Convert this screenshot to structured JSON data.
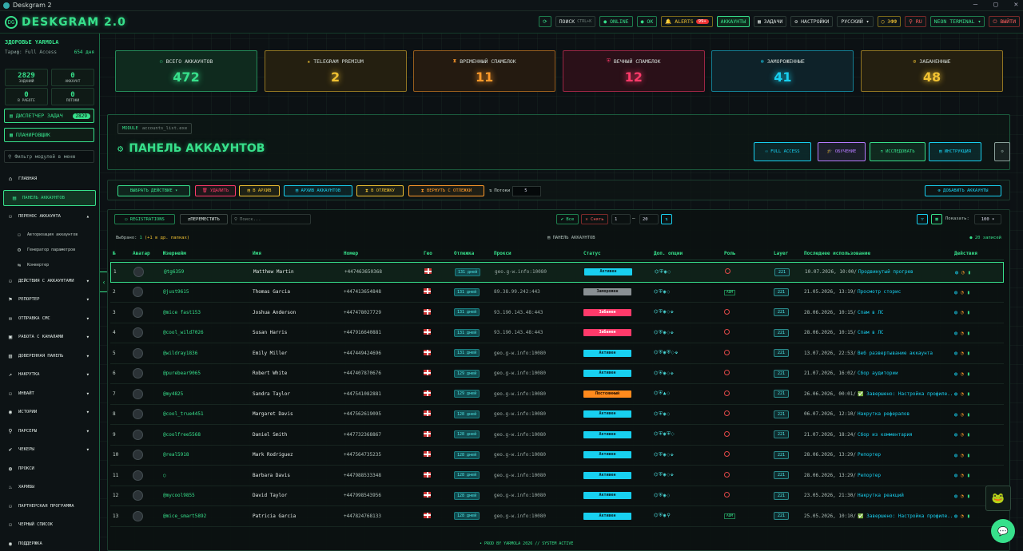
{
  "window": {
    "title": "Deskgram 2",
    "minimize": "—",
    "maximize": "▢",
    "close": "✕"
  },
  "header": {
    "logo": "DESKGRAM 2.0",
    "buttons": [
      {
        "label": "⟳",
        "cls": "g",
        "name": "refresh-button"
      },
      {
        "label": "ПОИСК",
        "extra": "CTRL+K",
        "cls": "",
        "name": "search-button"
      },
      {
        "label": "● ONLINE",
        "cls": "g",
        "name": "online-status-button"
      },
      {
        "label": "● OK",
        "cls": "g",
        "name": "ok-status-button"
      },
      {
        "label": "🔔 ALERTS",
        "badge": "99+",
        "cls": "y",
        "name": "alerts-button"
      },
      {
        "label": "АККАУНТЫ",
        "cls": "act",
        "name": "accounts-tab-button"
      },
      {
        "label": "▦ ЗАДАЧИ",
        "cls": "",
        "name": "tasks-button"
      },
      {
        "label": "⚙ НАСТРОЙКИ",
        "cls": "",
        "name": "settings-button"
      },
      {
        "label": "РУССКИЙ ▾",
        "cls": "",
        "name": "language-select"
      },
      {
        "label": "◯ ЭФФ",
        "cls": "y",
        "name": "effects-toggle"
      },
      {
        "label": "⚲ RU",
        "cls": "r",
        "name": "region-button"
      },
      {
        "label": "NEON TERMINAL ▾",
        "cls": "g",
        "name": "theme-select"
      },
      {
        "label": "⏻ ВЫЙТИ",
        "cls": "r",
        "name": "logout-button"
      }
    ]
  },
  "sidebar": {
    "user": "ЗДОРОВЬЕ YARMOLA",
    "plan": "Тариф: Full Access",
    "days": "654 дня",
    "stats": [
      {
        "n": "2829",
        "l": "ЗАДАНИЙ"
      },
      {
        "n": "0",
        "l": "АККАУНТ"
      },
      {
        "n": "0",
        "l": "В РАБОТЕ"
      },
      {
        "n": "0",
        "l": "ПОТОКИ"
      }
    ],
    "dispatcher": "ДИСПЕТЧЕР ЗАДАЧ",
    "dispatcher_badge": "2829",
    "scheduler": "ПЛАНИРОВЩИК",
    "filter_placeholder": "Фильтр модулей в меню",
    "nav": [
      {
        "label": "ГЛАВНАЯ",
        "icon": "⌂",
        "t": "main"
      },
      {
        "label": "ПАНЕЛЬ АККАУНТОВ",
        "icon": "▤",
        "t": "active"
      },
      {
        "label": "ПЕРЕНОС АККАУНТА",
        "icon": "⚇",
        "t": "open"
      },
      {
        "label": "Авторизация аккаунтов",
        "icon": "⚇",
        "t": "sub"
      },
      {
        "label": "Генератор параметров",
        "icon": "⚙",
        "t": "sub"
      },
      {
        "label": "Конвертер",
        "icon": "⇆",
        "t": "sub"
      },
      {
        "label": "ДЕЙСТВИЯ С АККАУНТАМИ",
        "icon": "⚇",
        "t": "exp"
      },
      {
        "label": "РЕПОРТЕР",
        "icon": "⚑",
        "t": "exp"
      },
      {
        "label": "ОТПРАВКА СМС",
        "icon": "✉",
        "t": "exp"
      },
      {
        "label": "РАБОТА С КАНАЛАМИ",
        "icon": "▣",
        "t": "exp"
      },
      {
        "label": "ДОВЕРЕННАЯ ПАНЕЛЬ",
        "icon": "▥",
        "t": "exp"
      },
      {
        "label": "НАКРУТКА",
        "icon": "↗",
        "t": "exp"
      },
      {
        "label": "ИНВАЙТ",
        "icon": "⚇",
        "t": "exp"
      },
      {
        "label": "ИСТОРИИ",
        "icon": "◉",
        "t": "exp"
      },
      {
        "label": "ПАРСЕРЫ",
        "icon": "⚲",
        "t": "exp"
      },
      {
        "label": "ЧЕКЕРЫ",
        "icon": "✔",
        "t": "exp"
      },
      {
        "label": "ПРОКСИ",
        "icon": "◍",
        "t": "main"
      },
      {
        "label": "ХАРИБЫ",
        "icon": "♨",
        "t": "main"
      },
      {
        "label": "ПАРТНЕРСКАЯ ПРОГРАММА",
        "icon": "⚇",
        "t": "main"
      },
      {
        "label": "ЧЕРНЫЙ СПИСОК",
        "icon": "⚇",
        "t": "main"
      },
      {
        "label": "ПОДДЕРЖКА",
        "icon": "◉",
        "t": "main"
      }
    ]
  },
  "stats": [
    {
      "label": "ВСЕГО АККАУНТОВ",
      "icon": "⚇",
      "value": "472",
      "color": "#37e08b",
      "bg": "#0f2a1e"
    },
    {
      "label": "TELEGRAM PREMIUM",
      "icon": "★",
      "value": "2",
      "color": "#f1c232",
      "bg": "#241f10"
    },
    {
      "label": "ВРЕМЕННЫЙ СПАМБЛОК",
      "icon": "⧗",
      "value": "11",
      "color": "#ff9a2a",
      "bg": "#241a10"
    },
    {
      "label": "ВЕЧНЫЙ СПАМБЛОК",
      "icon": "⛨",
      "value": "12",
      "color": "#ff3a6a",
      "bg": "#2a1018"
    },
    {
      "label": "ЗАМОРОЖЕННЫЕ",
      "icon": "❄",
      "value": "41",
      "color": "#18d0f0",
      "bg": "#0e2229"
    },
    {
      "label": "ЗАБАНЕННЫЕ",
      "icon": "⊘",
      "value": "48",
      "color": "#f1c232",
      "bg": "#241f10"
    }
  ],
  "panel": {
    "module": "MODULE",
    "file": "accounts_list.exe",
    "title": "ПАНЕЛЬ АККАУНТОВ",
    "buttons": [
      {
        "label": "⚇ FULL ACCESS",
        "color": "#18d0f0",
        "name": "full-access-button"
      },
      {
        "label": "🎓 ОБУЧЕНИЕ",
        "color": "#b57bff",
        "name": "tutorial-button"
      },
      {
        "label": "⚗ ИССЛЕДОВАТЬ",
        "color": "#37e08b",
        "name": "explore-button"
      },
      {
        "label": "▤ ИНСТРУКЦИЯ",
        "color": "#18d0f0",
        "name": "instruction-button"
      },
      {
        "label": "⚙",
        "color": "#8aa09a",
        "name": "panel-settings-button"
      }
    ]
  },
  "actions": {
    "buttons": [
      {
        "label": "ВЫБРАТЬ ДЕЙСТВИЕ ▾",
        "color": "#37e08b",
        "name": "choose-action-select"
      },
      {
        "label": "🗑 УДАЛИТЬ",
        "color": "#ff3a6a",
        "name": "delete-button"
      },
      {
        "label": "▤ В АРХИВ",
        "color": "#f1c232",
        "name": "archive-button"
      },
      {
        "label": "▤ АРХИВ АККАУНТОВ",
        "color": "#18d0f0",
        "name": "accounts-archive-button"
      },
      {
        "label": "⧗ В ОТЛЕЖКУ",
        "color": "#f1c232",
        "name": "to-rest-button"
      },
      {
        "label": "⧗ ВЕРНУТЬ С ОТЛЕЖКИ",
        "color": "#ff9a2a",
        "name": "return-from-rest-button"
      }
    ],
    "threads_label": "Потоки",
    "threads_value": "5",
    "add": "⊕ ДОБАВИТЬ АККАУНТЫ"
  },
  "toolbar": {
    "registrations": "▭ REGISTRATIONS",
    "move": "⇄ПЕРЕМЕСТИТЬ",
    "search_placeholder": "Поиск...",
    "all": "✔ Все",
    "clear": "✕ Снять",
    "from": "1",
    "dash": "—",
    "to": "20",
    "swap": "⇅",
    "filter": "▽",
    "grid": "▦",
    "show_label": "Показать:",
    "show_value": "100 ▾",
    "selected": "Выбрано:",
    "selected_count": "1",
    "selected_extra": "(+1 в др. папках)",
    "center": "▤ ПАНЕЛЬ АККАУНТОВ",
    "records": "● 20 записей"
  },
  "columns": [
    "№",
    "Аватар",
    "Юзернейм",
    "Имя",
    "Номер",
    "Гео",
    "Отлежка",
    "Прокси",
    "Статус",
    "Доп. опции",
    "Роль",
    "Layer",
    "Последнее использование",
    "Действия"
  ],
  "rows": [
    {
      "n": "1",
      "user": "@tg6359",
      "name": "Matthew Martin",
      "phone": "+447463650368",
      "days": "131 дней",
      "proxy": "geo.g-w.info:10080",
      "status": "Активен",
      "sc": "a",
      "opts": "⌬⛨◉◌",
      "role": "",
      "last": "10.07.2026, 10:00/",
      "lastd": "Продвинутый прогрев",
      "sel": true
    },
    {
      "n": "2",
      "user": "@just9615",
      "name": "Thomas Garcia",
      "phone": "+447413654848",
      "days": "131 дней",
      "proxy": "89.38.99.242:443",
      "status": "Заморожен",
      "sc": "z",
      "opts": "⌬⛨◉◌",
      "role": "tag",
      "last": "21.05.2026, 13:19/",
      "lastd": "Просмотр сторис"
    },
    {
      "n": "3",
      "user": "@mice fast153",
      "name": "Joshua Anderson",
      "phone": "+447478027729",
      "days": "131 дней",
      "proxy": "93.190.143.48:443",
      "status": "Забанен",
      "sc": "b",
      "opts": "⌬⛨◉◌⬙",
      "role": "",
      "last": "28.06.2026, 10:15/",
      "lastd": "Спам в ЛС"
    },
    {
      "n": "4",
      "user": "@cool_wild7026",
      "name": "Susan Harris",
      "phone": "+447916640881",
      "days": "131 дней",
      "proxy": "93.190.143.48:443",
      "status": "Забанен",
      "sc": "b",
      "opts": "⌬⛨◉◌⬙",
      "role": "",
      "last": "28.06.2026, 10:15/",
      "lastd": "Спам в ЛС"
    },
    {
      "n": "5",
      "user": "@wildray1836",
      "name": "Emily Miller",
      "phone": "+447449424696",
      "days": "131 дней",
      "proxy": "geo.g-w.info:10080",
      "status": "Активен",
      "sc": "a",
      "opts": "⌬⛨◉⛨◌⬙",
      "role": "",
      "last": "13.07.2026, 22:53/",
      "lastd": "Веб развертывание аккаунта"
    },
    {
      "n": "6",
      "user": "@purebear9065",
      "name": "Robert White",
      "phone": "+447407870676",
      "days": "129 дней",
      "proxy": "geo.g-w.info:10080",
      "status": "Активен",
      "sc": "a",
      "opts": "⌬⛨◉◌⬙",
      "role": "",
      "last": "21.07.2026, 16:02/",
      "lastd": "Сбор аудитории"
    },
    {
      "n": "7",
      "user": "@my4825",
      "name": "Sandra Taylor",
      "phone": "+447541082881",
      "days": "129 дней",
      "proxy": "geo.g-w.info:10080",
      "status": "Постоянный",
      "sc": "p",
      "opts": "⌬⛨▲◌",
      "role": "",
      "last": "26.06.2026, 00:01/",
      "lastd": "✅ Завершено: Настройка профиле..."
    },
    {
      "n": "8",
      "user": "@cool_true4451",
      "name": "Margaret Davis",
      "phone": "+447562619095",
      "days": "128 дней",
      "proxy": "geo.g-w.info:10080",
      "status": "Активен",
      "sc": "a",
      "opts": "⌬⛨◉◌",
      "role": "",
      "last": "06.07.2026, 12:10/",
      "lastd": "Накрутка рефералов"
    },
    {
      "n": "9",
      "user": "@coolfree5568",
      "name": "Daniel Smith",
      "phone": "+447732368867",
      "days": "128 дней",
      "proxy": "geo.g-w.info:10080",
      "status": "Активен",
      "sc": "a",
      "opts": "⌬⛨◉⛨◌",
      "role": "",
      "last": "21.07.2026, 18:24/",
      "lastd": "Сбор из комментария"
    },
    {
      "n": "10",
      "user": "@real5918",
      "name": "Mark Rodriguez",
      "phone": "+447564735235",
      "days": "128 дней",
      "proxy": "geo.g-w.info:10080",
      "status": "Активен",
      "sc": "a",
      "opts": "⌬⛨◉◌⬙",
      "role": "",
      "last": "28.06.2026, 13:29/",
      "lastd": "Репортер"
    },
    {
      "n": "11",
      "user": "○",
      "name": "Barbara Davis",
      "phone": "+447988533348",
      "days": "128 дней",
      "proxy": "geo.g-w.info:10080",
      "status": "Активен",
      "sc": "a",
      "opts": "⌬⛨◉◌⬙",
      "role": "",
      "last": "28.06.2026, 13:29/",
      "lastd": "Репортер"
    },
    {
      "n": "12",
      "user": "@mycool9855",
      "name": "David Taylor",
      "phone": "+447998543956",
      "days": "128 дней",
      "proxy": "geo.g-w.info:10080",
      "status": "Активен",
      "sc": "a",
      "opts": "⌬⛨◉◌",
      "role": "",
      "last": "23.05.2026, 21:30/",
      "lastd": "Накрутка реакций"
    },
    {
      "n": "13",
      "user": "@mice_smart5892",
      "name": "Patricia Garcia",
      "phone": "+447824768133",
      "days": "128 дней",
      "proxy": "geo.g-w.info:10080",
      "status": "Активен",
      "sc": "a",
      "opts": "⌬⛨◉⚲",
      "role": "tag",
      "last": "25.05.2026, 10:10/",
      "lastd": "✅ Завершено: Настройка профиле..."
    }
  ],
  "role_tag": "ADM",
  "footer": "• PROD BY YARMOLA 2026   // SYSTEM ACTIVE"
}
